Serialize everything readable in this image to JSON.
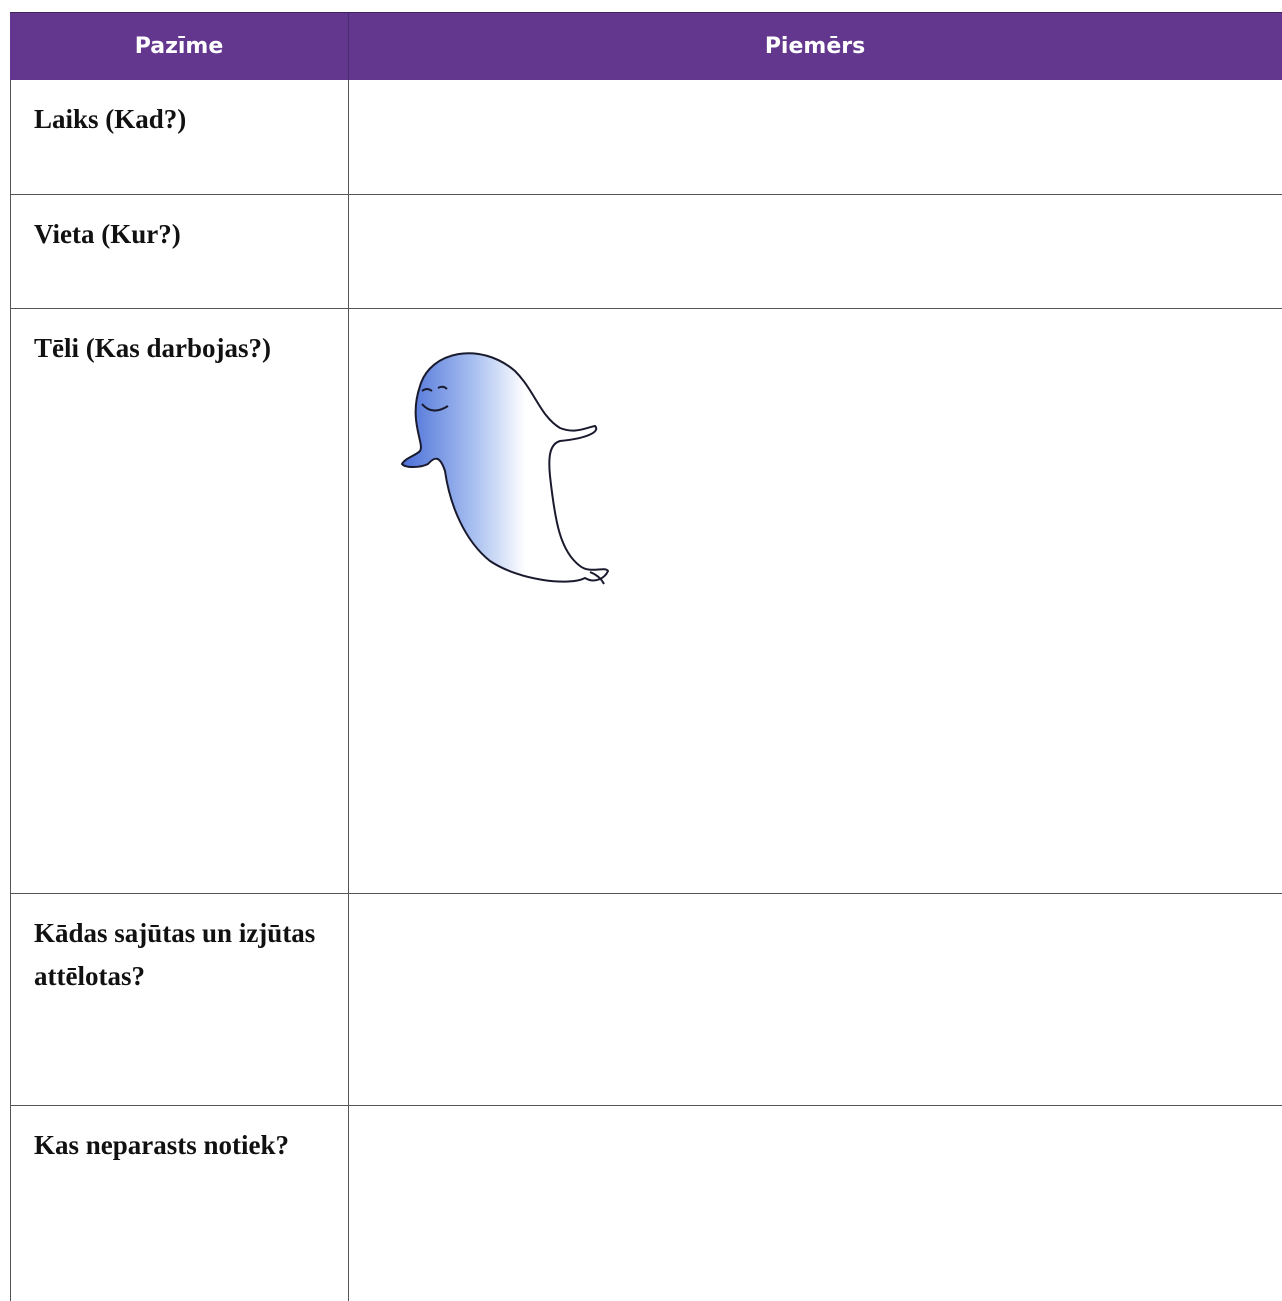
{
  "table": {
    "headers": [
      "Pazīme",
      "Piemērs"
    ],
    "rows": [
      {
        "label": "Laiks (Kad?)",
        "answer": ""
      },
      {
        "label": "Vieta (Kur?)",
        "answer": ""
      },
      {
        "label": "Tēli (Kas darbojas?)",
        "answer": ""
      },
      {
        "label": "Kādas sajūtas un izjūtas attēlotas?",
        "answer": ""
      },
      {
        "label": "Kas neparasts notiek?",
        "answer": ""
      }
    ]
  },
  "illustration": {
    "name": "ghost-illustration",
    "colors": {
      "outline": "#1a1a2e",
      "shade": "#4a6fd8",
      "fill": "#ffffff"
    }
  },
  "colors": {
    "header_bg": "#64378f",
    "header_text": "#ffffff",
    "border": "#555555"
  }
}
